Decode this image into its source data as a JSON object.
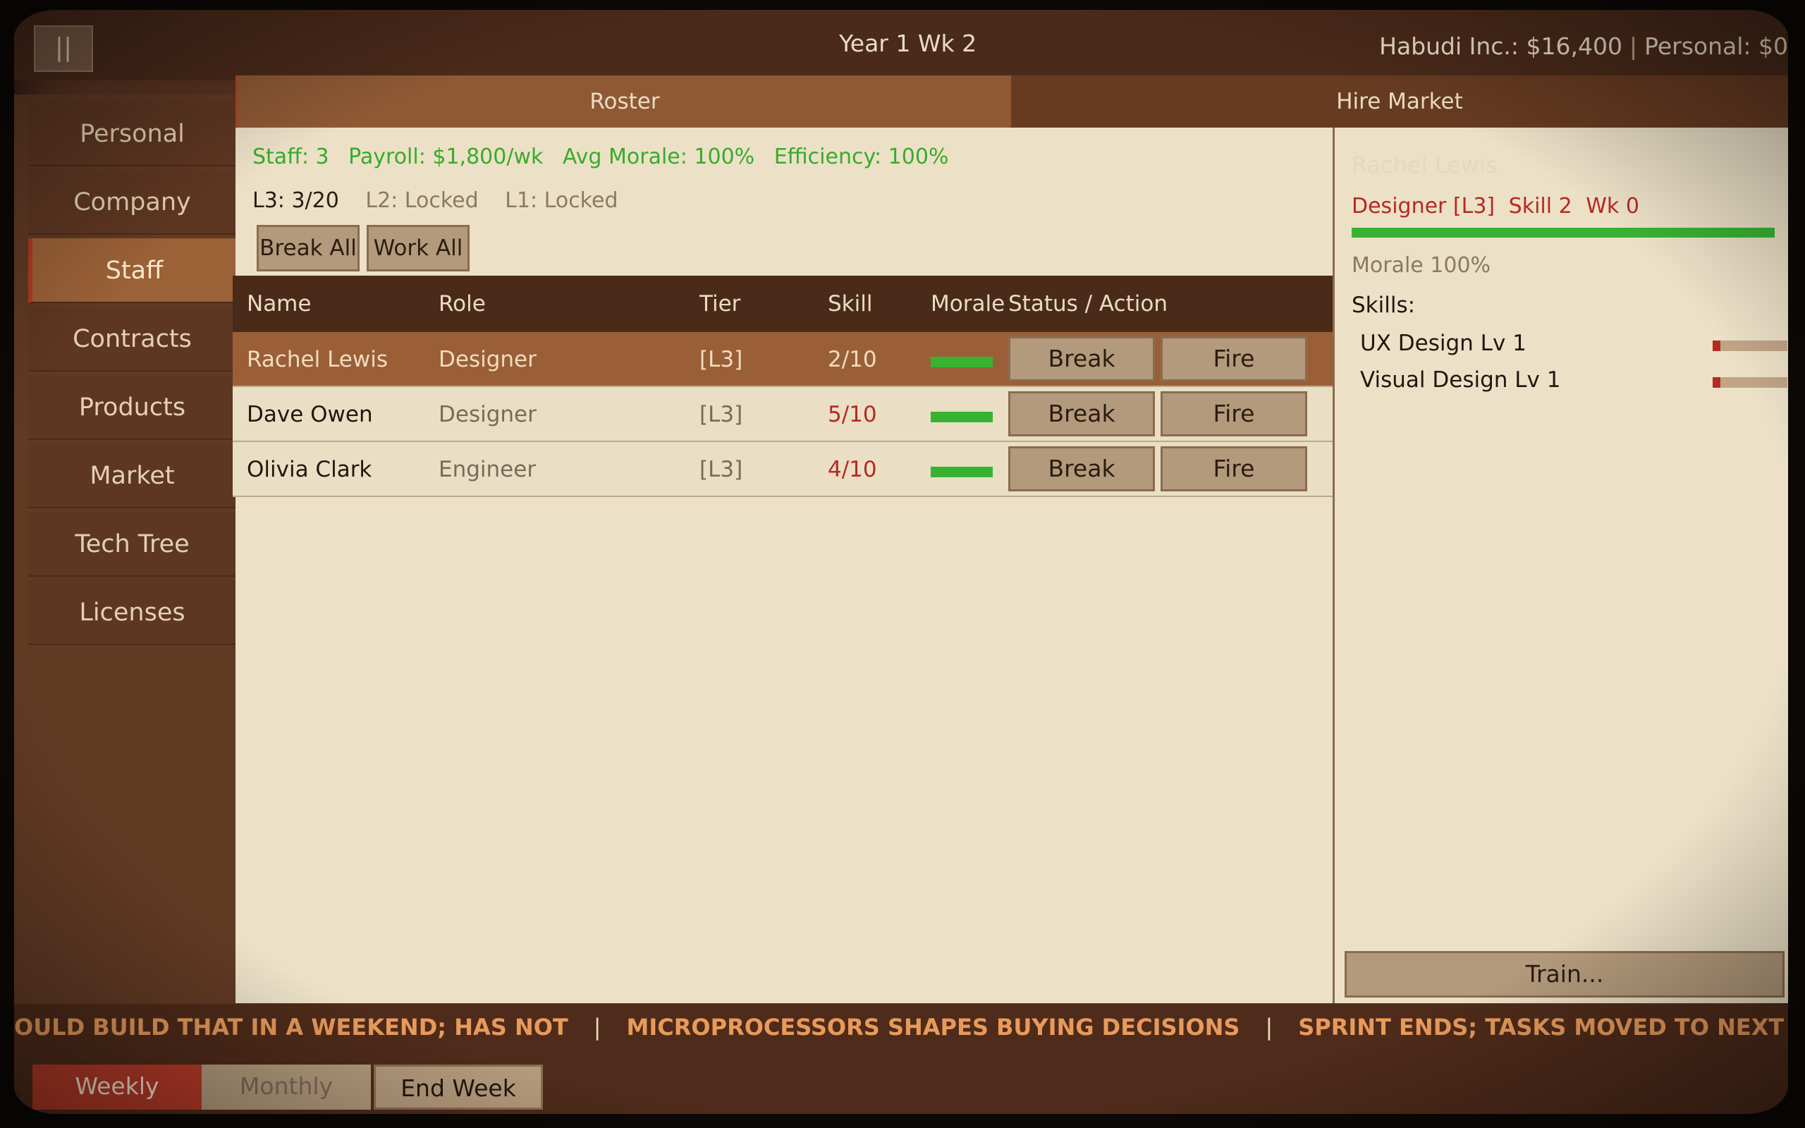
{
  "top": {
    "pause_glyph": "||",
    "date": "Year 1  Wk 2",
    "company_money": "Habudi Inc.: $16,400",
    "separator": "|",
    "personal_money": "Personal: $0"
  },
  "sidebar": {
    "items": [
      {
        "label": "Personal"
      },
      {
        "label": "Company"
      },
      {
        "label": "Staff"
      },
      {
        "label": "Contracts"
      },
      {
        "label": "Products"
      },
      {
        "label": "Market"
      },
      {
        "label": "Tech Tree"
      },
      {
        "label": "Licenses"
      }
    ],
    "active": "Staff"
  },
  "tabs": {
    "roster": "Roster",
    "hire_market": "Hire Market"
  },
  "stats": {
    "staff": "Staff: 3",
    "payroll": "Payroll: $1,800/wk",
    "avg_morale": "Avg Morale: 100%",
    "efficiency": "Efficiency: 100%"
  },
  "tiers": {
    "l3": "L3: 3/20",
    "l2": "L2: Locked",
    "l1": "L1: Locked"
  },
  "bulk": {
    "break_all": "Break All",
    "work_all": "Work All"
  },
  "table": {
    "headers": {
      "name": "Name",
      "role": "Role",
      "tier": "Tier",
      "skill": "Skill",
      "morale": "Morale",
      "status": "Status / Action"
    },
    "rows": [
      {
        "name": "Rachel Lewis",
        "role": "Designer",
        "tier": "[L3]",
        "skill": "2/10",
        "morale": 1.0,
        "break": "Break",
        "fire": "Fire"
      },
      {
        "name": "Dave Owen",
        "role": "Designer",
        "tier": "[L3]",
        "skill": "5/10",
        "morale": 1.0,
        "break": "Break",
        "fire": "Fire"
      },
      {
        "name": "Olivia Clark",
        "role": "Engineer",
        "tier": "[L3]",
        "skill": "4/10",
        "morale": 1.0,
        "break": "Break",
        "fire": "Fire"
      }
    ]
  },
  "detail": {
    "name": "Rachel Lewis",
    "role_tier": "Designer [L3]",
    "skill": "Skill 2",
    "week": "Wk 0",
    "morale_label": "Morale 100%",
    "morale": 1.0,
    "skills_heading": "Skills:",
    "skills": [
      {
        "name": "UX Design  Lv 1",
        "level": 0.1
      },
      {
        "name": "Visual Design  Lv 1",
        "level": 0.1
      }
    ],
    "train": "Train..."
  },
  "ticker": {
    "items": [
      "OULD BUILD THAT IN A WEEKEND; HAS NOT",
      "MICROPROCESSORS SHAPES BUYING DECISIONS",
      "SPRINT ENDS; TASKS MOVED TO NEXT SPRINT AS PLANNED"
    ],
    "separator": "|"
  },
  "bottom": {
    "weekly": "Weekly",
    "monthly": "Monthly",
    "end_week": "End Week"
  },
  "colors": {
    "accent_red": "#b52a22",
    "morale_green": "#38b232",
    "stat_green": "#3aaa2c"
  }
}
